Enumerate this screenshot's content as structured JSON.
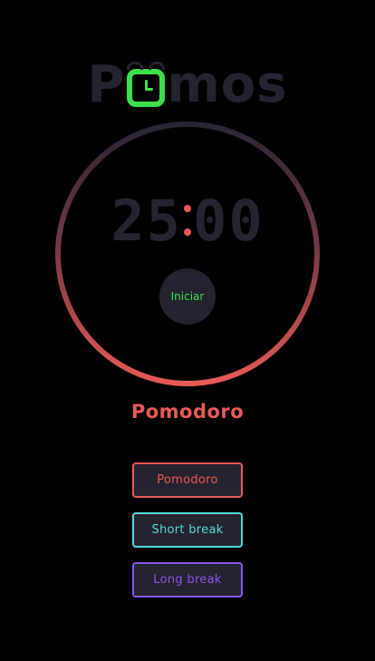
{
  "logo": {
    "prefix": "P",
    "suffix": "mos",
    "icon": "clock-icon"
  },
  "timer": {
    "minutes": "25",
    "seconds": "00",
    "start_label": "Iniciar"
  },
  "mode": {
    "title": "Pomodoro"
  },
  "modes": {
    "pomodoro_label": "Pomodoro",
    "short_break_label": "Short break",
    "long_break_label": "Long break"
  },
  "colors": {
    "background": "#000000",
    "accent_green": "#3ce04a",
    "pomodoro_red": "#e85a57",
    "short_break_cyan": "#57d6d6",
    "long_break_purple": "#8a56e8",
    "surface": "#25232f"
  }
}
